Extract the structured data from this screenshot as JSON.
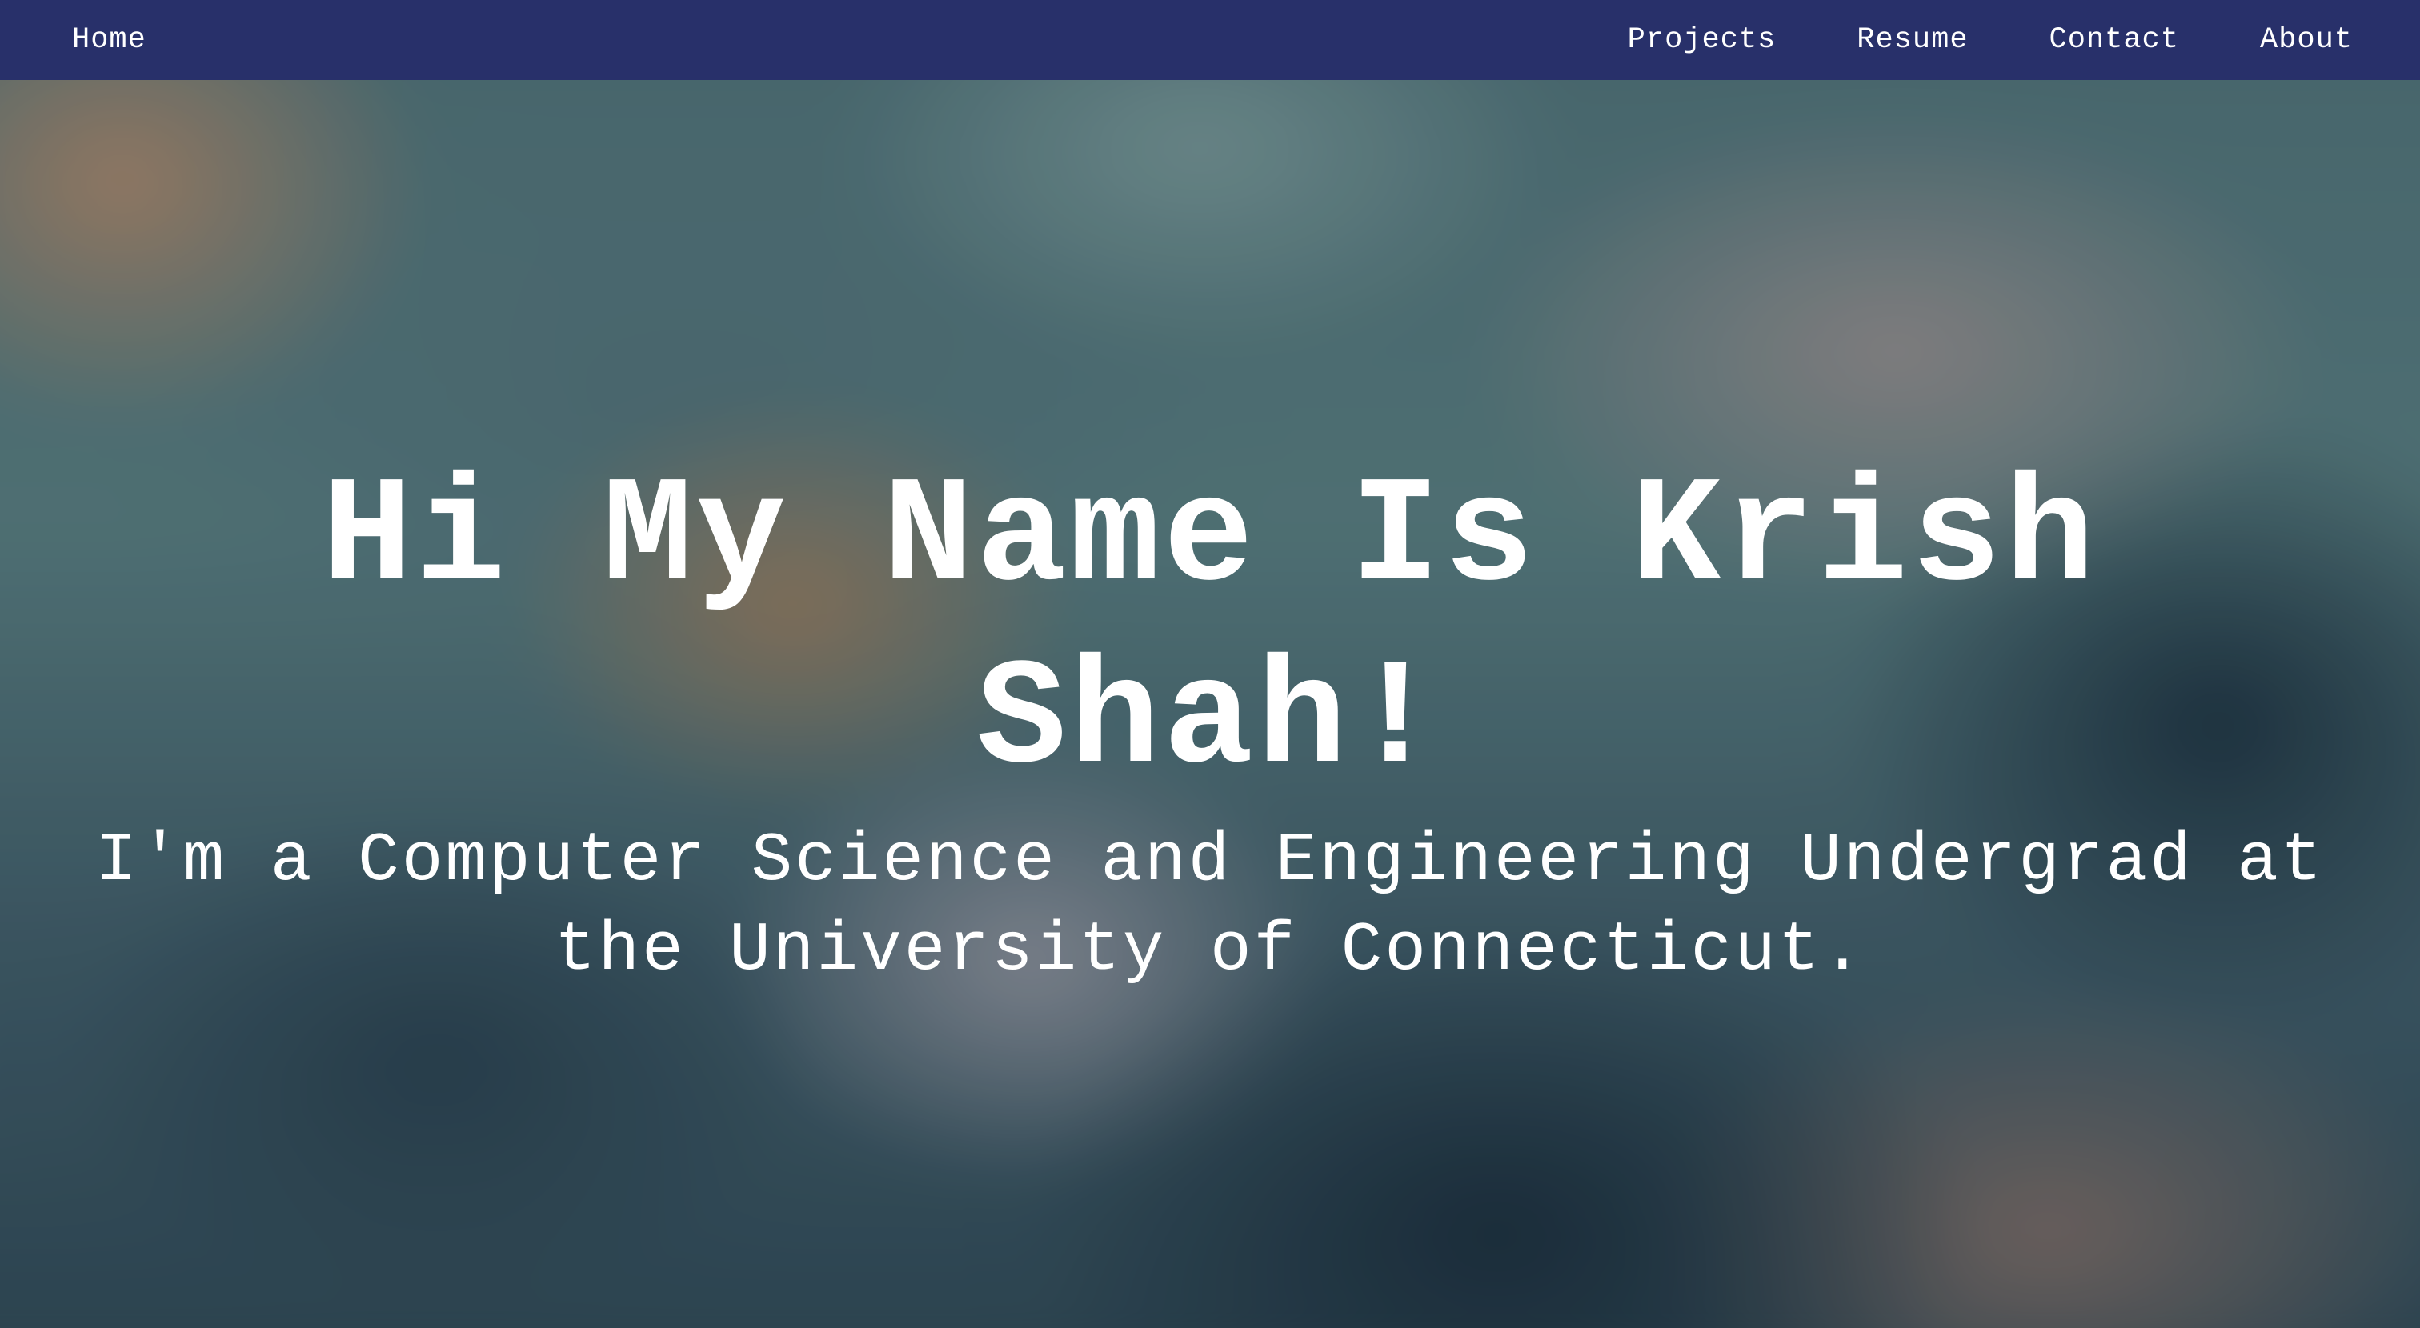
{
  "nav": {
    "home": "Home",
    "links": [
      {
        "label": "Projects"
      },
      {
        "label": "Resume"
      },
      {
        "label": "Contact"
      },
      {
        "label": "About"
      }
    ],
    "background_color": "#28306a"
  },
  "hero": {
    "title": "Hi My Name Is Krish Shah!",
    "subtitle": "I'm a Computer Science and Engineering Undergrad at the University of Connecticut."
  }
}
